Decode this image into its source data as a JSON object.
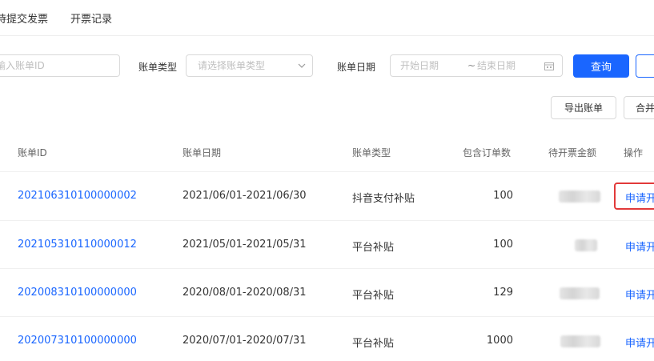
{
  "tabs": [
    {
      "label": "待提交发票"
    },
    {
      "label": "开票记录"
    }
  ],
  "filters": {
    "bill_id_placeholder": "输入账单ID",
    "bill_type_label": "账单类型",
    "bill_type_placeholder": "请选择账单类型",
    "bill_date_label": "账单日期",
    "start_date_placeholder": "开始日期",
    "date_separator": "~",
    "end_date_placeholder": "结束日期",
    "query_label": "查询"
  },
  "actions": {
    "export_label": "导出账单",
    "merge_label": "合并"
  },
  "table": {
    "headers": {
      "bill_id": "账单ID",
      "bill_date": "账单日期",
      "bill_type": "账单类型",
      "order_count": "包含订单数",
      "pending_amount": "待开票金额",
      "operation": "操作"
    },
    "rows": [
      {
        "bill_id": "202106310100000002",
        "bill_date": "2021/06/01-2021/06/30",
        "bill_type": "抖音支付补贴",
        "order_count": "100",
        "action": "申请开"
      },
      {
        "bill_id": "202105310110000012",
        "bill_date": "2021/05/01-2021/05/31",
        "bill_type": "平台补贴",
        "order_count": "100",
        "action": "申请开"
      },
      {
        "bill_id": "202008310100000000",
        "bill_date": "2020/08/01-2020/08/31",
        "bill_type": "平台补贴",
        "order_count": "129",
        "action": "申请开"
      },
      {
        "bill_id": "202007310100000000",
        "bill_date": "2020/07/01-2020/07/31",
        "bill_type": "平台补贴",
        "order_count": "1000",
        "action": "申请开"
      }
    ]
  },
  "colors": {
    "accent": "#1a66ff",
    "highlight": "#e23a3a"
  },
  "icons": {
    "select_arrow": "chevron-down-icon",
    "date_picker": "calendar-icon"
  }
}
